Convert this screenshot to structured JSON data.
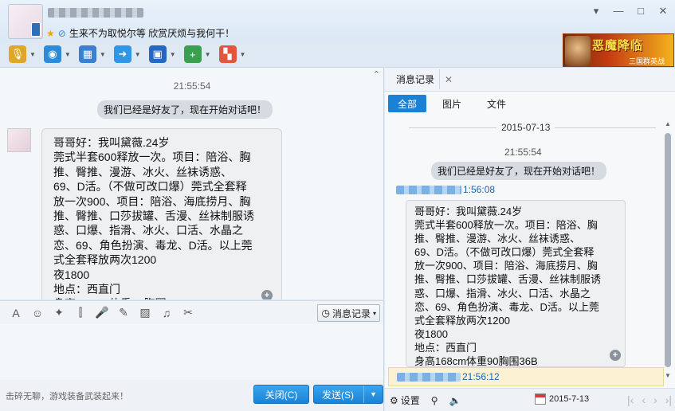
{
  "window": {
    "mood": "生来不为取悦尔等 欣赏厌烦与我何干！",
    "controls": {
      "menu": "▾",
      "minimize": "—",
      "maximize": "□",
      "close": "✕"
    }
  },
  "toolbar": {
    "items": [
      {
        "name": "voice-call",
        "icon": "🎙",
        "color": "#e0a62a"
      },
      {
        "name": "video-call",
        "icon": "◉",
        "color": "#2c8ad8"
      },
      {
        "name": "remote-desktop",
        "icon": "▦",
        "color": "#3a7fd0"
      },
      {
        "name": "send-file",
        "icon": "➜",
        "color": "#2f97e5"
      },
      {
        "name": "screen-share",
        "icon": "▣",
        "color": "#2468c4"
      },
      {
        "name": "create-discussion",
        "icon": "+",
        "color": "#3aa050"
      },
      {
        "name": "apps",
        "icon": "▚",
        "color": "#e2563d"
      }
    ],
    "ad_title": "恶魔降临",
    "ad_subtitle": "三国群英战"
  },
  "chat": {
    "time": "21:55:54",
    "system_message": "我们已经是好友了，现在开始对话吧！",
    "message_text": "哥哥好：我叫黛薇.24岁\n莞式半套600释放一次。项目：陪浴、胸\n推、臀推、漫游、冰火、丝袜诱惑、\n69、D活。（不做可改口爆）莞式全套释\n放一次900、项目：陪浴、海底捞月、胸\n推、臀推、口莎拔罐、舌漫、丝袜制服诱\n惑、口爆、指滑、冰火、口活、水晶之\n恋、69、角色扮演、毒龙、D活。以上莞\n式全套释放两次1200\n夜1800\n地点：西直门\n身高168cm体重90胸围36B",
    "collapse_icon": "⌃"
  },
  "input_toolbar": {
    "tools": [
      {
        "name": "font",
        "icon": "A"
      },
      {
        "name": "emoji",
        "icon": "☺"
      },
      {
        "name": "magic",
        "icon": "✦"
      },
      {
        "name": "shake",
        "icon": "⫿"
      },
      {
        "name": "voice-msg",
        "icon": "🎤"
      },
      {
        "name": "edit",
        "icon": "✎"
      },
      {
        "name": "image",
        "icon": "▨"
      },
      {
        "name": "music",
        "icon": "♫"
      },
      {
        "name": "screenshot",
        "icon": "✂"
      }
    ],
    "history_label": "消息记录"
  },
  "bottom": {
    "hint": "击碎无聊，游戏装备武装起来！",
    "close_label": "关闭(C)",
    "send_label": "发送(S)"
  },
  "history": {
    "tab_label": "消息记录",
    "filters": [
      "全部",
      "图片",
      "文件"
    ],
    "date": "2015-07-13",
    "time": "21:55:54",
    "system_message": "我们已经是好友了，现在开始对话吧！",
    "sender_time": "1:56:08",
    "message_text": "哥哥好：我叫黛薇.24岁\n莞式半套600释放一次。项目：陪浴、胸\n推、臀推、漫游、冰火、丝袜诱惑、\n69、D活。（不做可改口爆）莞式全套释\n放一次900、项目：陪浴、海底捞月、胸\n推、臀推、口莎拔罐、舌漫、丝袜制服诱\n惑、口爆、指滑、冰火、口活、水晶之\n恋、69、角色扮演、毒龙、D活。以上莞\n式全套释放两次1200\n夜1800\n地点：西直门\n身高168cm体重90胸围36B",
    "selected_time": "21:56:12",
    "settings_label": "设置",
    "footer_date": "2015-7-13",
    "pager": [
      "|‹",
      "‹",
      "›",
      "›|"
    ]
  }
}
